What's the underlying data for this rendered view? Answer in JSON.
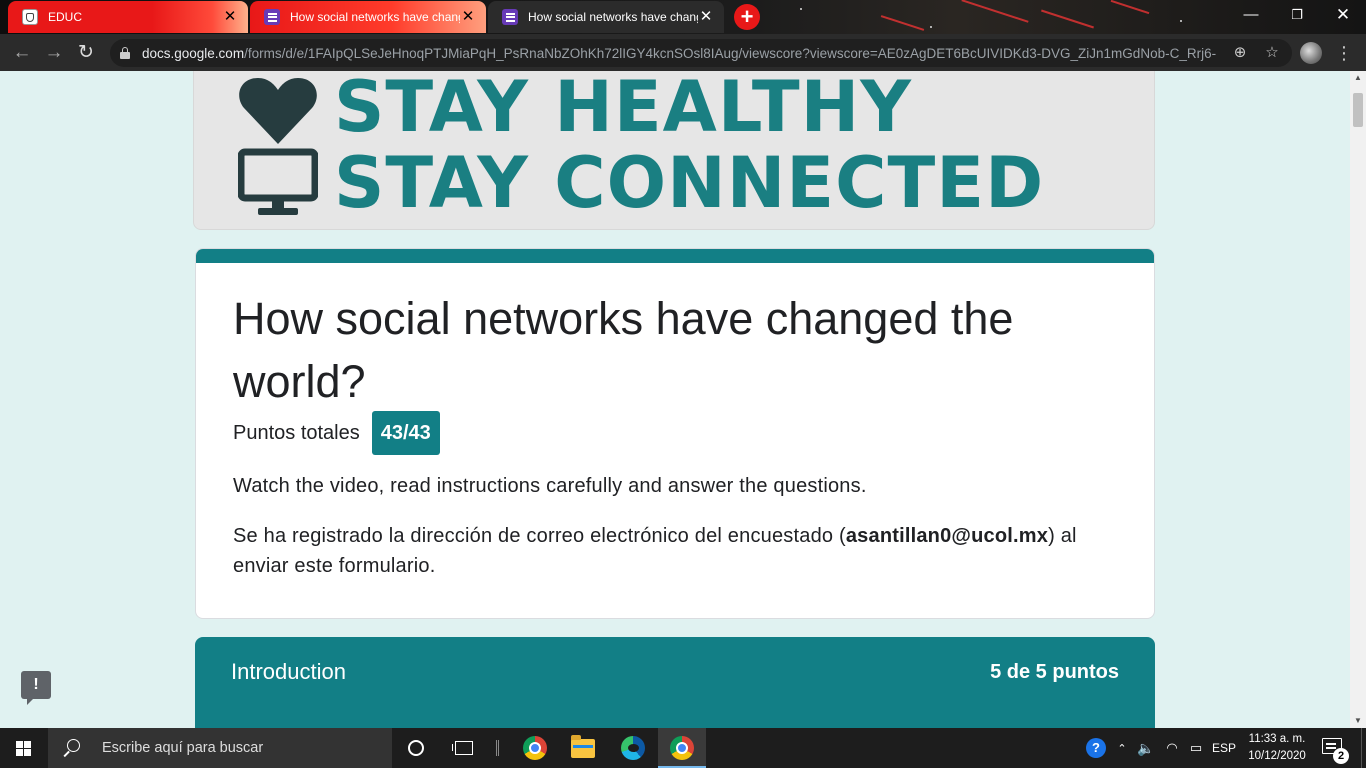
{
  "browser": {
    "tabs": [
      {
        "title": "EDUC",
        "favicon": "educ-crest-icon"
      },
      {
        "title": "How social networks have changed",
        "favicon": "google-forms-icon"
      },
      {
        "title": "How social networks have changed",
        "favicon": "google-forms-icon"
      }
    ],
    "active_tab_index": 2,
    "new_tab_label": "+",
    "url_host": "docs.google.com",
    "url_path": "/forms/d/e/1FAIpQLSeJeHnoqPTJMiaPqH_PsRnaNbZOhKh72lIGY4kcnSOsl8IAug/viewscore?viewscore=AE0zAgDET6BcUIVIDKd3-DVG_ZiJn1mGdNob-C_Rrj6-"
  },
  "banner": {
    "line1": "STAY HEALTHY",
    "line2": "STAY CONNECTED",
    "text_color": "#1a7f82"
  },
  "form": {
    "title": "How social networks have changed the world?",
    "score_label": "Puntos totales",
    "score_value": "43/43",
    "description": "Watch the video, read instructions carefully and answer the questions.",
    "email_note_before": "Se ha registrado la dirección de correo electrónico del encuestado (",
    "email": "asantillan0@ucol.mx",
    "email_note_after": ") al enviar este formulario.",
    "accent_color": "#127f86"
  },
  "section": {
    "title": "Introduction",
    "points": "5 de 5 puntos"
  },
  "feedback_label": "!",
  "taskbar": {
    "search_placeholder": "Escribe aquí para buscar",
    "apps": [
      "chrome-icon",
      "file-explorer-icon",
      "edge-icon",
      "chrome-profile-icon"
    ],
    "language": "ESP",
    "time": "11:33 a. m.",
    "date": "10/12/2020",
    "notification_count": "2"
  }
}
